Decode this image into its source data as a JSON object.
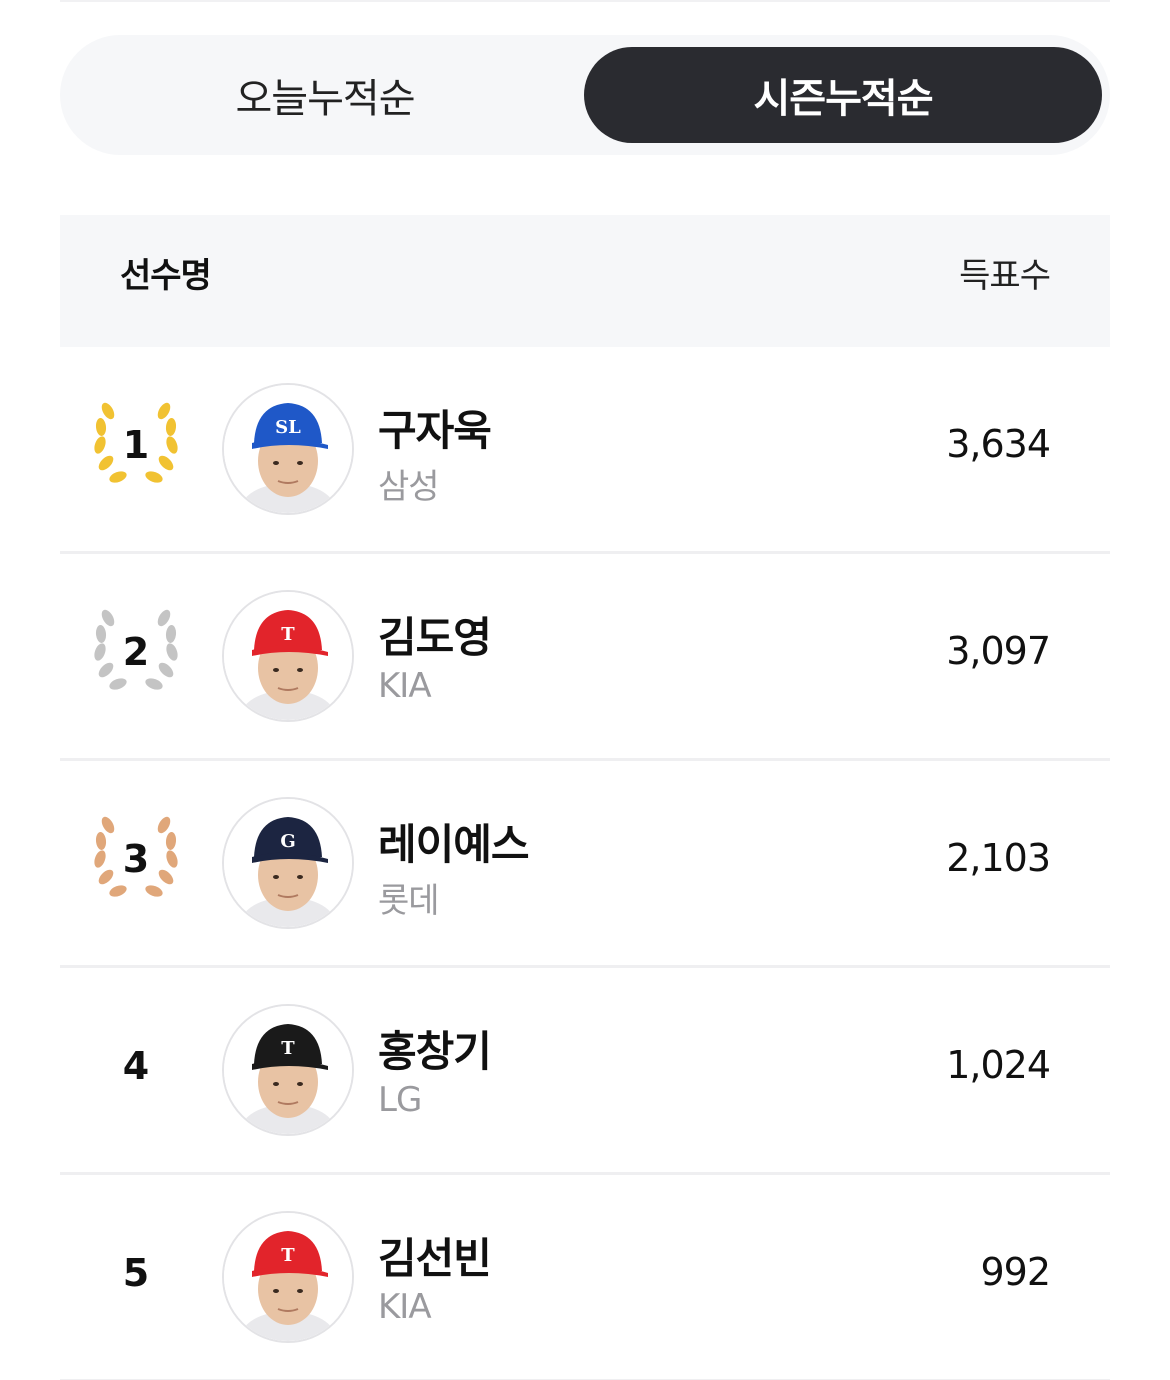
{
  "tabs": {
    "today": "오늘누적순",
    "season": "시즌누적순",
    "active": "season"
  },
  "table_header": {
    "name": "선수명",
    "votes": "득표수"
  },
  "rows": [
    {
      "rank": "1",
      "name": "구자욱",
      "team": "삼성",
      "votes": "3,634",
      "laurel": "gold",
      "cap_color": "#1f58c8",
      "cap_logo": "SL"
    },
    {
      "rank": "2",
      "name": "김도영",
      "team": "KIA",
      "votes": "3,097",
      "laurel": "silver",
      "cap_color": "#e2242b",
      "cap_logo": "T"
    },
    {
      "rank": "3",
      "name": "레이예스",
      "team": "롯데",
      "votes": "2,103",
      "laurel": "bronze",
      "cap_color": "#1c2541",
      "cap_logo": "G"
    },
    {
      "rank": "4",
      "name": "홍창기",
      "team": "LG",
      "votes": "1,024",
      "laurel": "none",
      "cap_color": "#1a1a1a",
      "cap_logo": "T"
    },
    {
      "rank": "5",
      "name": "김선빈",
      "team": "KIA",
      "votes": "992",
      "laurel": "none",
      "cap_color": "#e2242b",
      "cap_logo": "T"
    }
  ],
  "colors": {
    "gold": "#f1c232",
    "silver": "#c4c4c4",
    "bronze": "#e0a77a",
    "tab_active_bg": "#2a2b30",
    "header_bg": "#f6f7f9"
  }
}
